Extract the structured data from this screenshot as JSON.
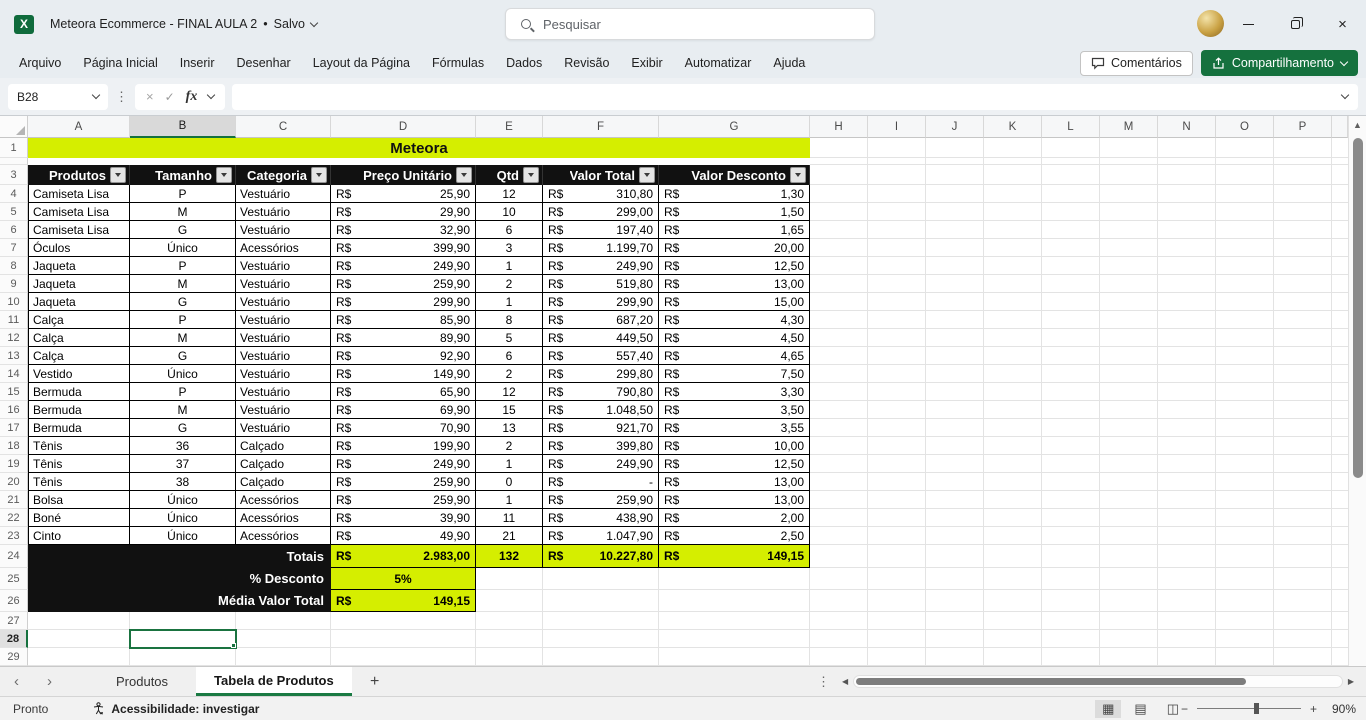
{
  "window": {
    "app_icon": "X",
    "title": "Meteora Ecommerce - FINAL AULA 2",
    "separator": "•",
    "saved_badge": "Salvo",
    "search_placeholder": "Pesquisar"
  },
  "menu": {
    "items": [
      "Arquivo",
      "Página Inicial",
      "Inserir",
      "Desenhar",
      "Layout da Página",
      "Fórmulas",
      "Dados",
      "Revisão",
      "Exibir",
      "Automatizar",
      "Ajuda"
    ]
  },
  "toolbar": {
    "comments_label": "Comentários",
    "share_label": "Compartilhamento"
  },
  "formula_bar": {
    "name_box": "B28",
    "fx_label": "fx",
    "formula_value": ""
  },
  "grid": {
    "columns": [
      "A",
      "B",
      "C",
      "D",
      "E",
      "F",
      "G",
      "H",
      "I",
      "J",
      "K",
      "L",
      "M",
      "N",
      "O",
      "P"
    ],
    "selected_column": "B",
    "selected_cell": "B28",
    "row_numbers": [
      "1",
      "3",
      "4",
      "5",
      "6",
      "7",
      "8",
      "9",
      "10",
      "11",
      "12",
      "13",
      "14",
      "15",
      "16",
      "17",
      "18",
      "19",
      "20",
      "21",
      "22",
      "23",
      "24",
      "25",
      "26",
      "27",
      "28",
      "29"
    ],
    "hidden_rows": [
      2
    ]
  },
  "sheet": {
    "title": "Meteora",
    "currency": "R$",
    "headers": [
      "Produtos",
      "Tamanho",
      "Categoria",
      "Preço Unitário",
      "Qtd",
      "Valor Total",
      "Valor Desconto"
    ],
    "rows": [
      [
        "Camiseta Lisa",
        "P",
        "Vestuário",
        "25,90",
        "12",
        "310,80",
        "1,30"
      ],
      [
        "Camiseta Lisa",
        "M",
        "Vestuário",
        "29,90",
        "10",
        "299,00",
        "1,50"
      ],
      [
        "Camiseta Lisa",
        "G",
        "Vestuário",
        "32,90",
        "6",
        "197,40",
        "1,65"
      ],
      [
        "Óculos",
        "Único",
        "Acessórios",
        "399,90",
        "3",
        "1.199,70",
        "20,00"
      ],
      [
        "Jaqueta",
        "P",
        "Vestuário",
        "249,90",
        "1",
        "249,90",
        "12,50"
      ],
      [
        "Jaqueta",
        "M",
        "Vestuário",
        "259,90",
        "2",
        "519,80",
        "13,00"
      ],
      [
        "Jaqueta",
        "G",
        "Vestuário",
        "299,90",
        "1",
        "299,90",
        "15,00"
      ],
      [
        "Calça",
        "P",
        "Vestuário",
        "85,90",
        "8",
        "687,20",
        "4,30"
      ],
      [
        "Calça",
        "M",
        "Vestuário",
        "89,90",
        "5",
        "449,50",
        "4,50"
      ],
      [
        "Calça",
        "G",
        "Vestuário",
        "92,90",
        "6",
        "557,40",
        "4,65"
      ],
      [
        "Vestido",
        "Único",
        "Vestuário",
        "149,90",
        "2",
        "299,80",
        "7,50"
      ],
      [
        "Bermuda",
        "P",
        "Vestuário",
        "65,90",
        "12",
        "790,80",
        "3,30"
      ],
      [
        "Bermuda",
        "M",
        "Vestuário",
        "69,90",
        "15",
        "1.048,50",
        "3,50"
      ],
      [
        "Bermuda",
        "G",
        "Vestuário",
        "70,90",
        "13",
        "921,70",
        "3,55"
      ],
      [
        "Tênis",
        "36",
        "Calçado",
        "199,90",
        "2",
        "399,80",
        "10,00"
      ],
      [
        "Tênis",
        "37",
        "Calçado",
        "249,90",
        "1",
        "249,90",
        "12,50"
      ],
      [
        "Tênis",
        "38",
        "Calçado",
        "259,90",
        "0",
        "-",
        "13,00"
      ],
      [
        "Bolsa",
        "Único",
        "Acessórios",
        "259,90",
        "1",
        "259,90",
        "13,00"
      ],
      [
        "Boné",
        "Único",
        "Acessórios",
        "39,90",
        "11",
        "438,90",
        "2,00"
      ],
      [
        "Cinto",
        "Único",
        "Acessórios",
        "49,90",
        "21",
        "1.047,90",
        "2,50"
      ]
    ],
    "totals": {
      "label": "Totais",
      "preco_unitario": "2.983,00",
      "qtd": "132",
      "valor_total": "10.227,80",
      "valor_desconto": "149,15"
    },
    "desconto": {
      "label": "% Desconto",
      "value": "5%"
    },
    "media": {
      "label": "Média Valor Total",
      "value": "149,15"
    }
  },
  "sheet_tabs": {
    "tabs": [
      "Produtos",
      "Tabela de Produtos"
    ],
    "active_tab": "Tabela de Produtos"
  },
  "status_bar": {
    "mode": "Pronto",
    "accessibility": "Acessibilidade: investigar",
    "zoom_level": "90%"
  },
  "icons": {
    "close": "×",
    "cancel": "×",
    "check": "✓",
    "more_vertical": "⋮",
    "prev": "‹",
    "next": "›",
    "add_sheet": "+",
    "left": "◀",
    "right": "▶",
    "up": "▲",
    "zoom_out": "−",
    "zoom_in": "+",
    "view_normal": "▦",
    "view_layout": "▤",
    "view_break": "◫"
  },
  "colors": {
    "accent_green": "#15713e",
    "table_accent": "#d5ee00",
    "header_black": "#111111"
  }
}
